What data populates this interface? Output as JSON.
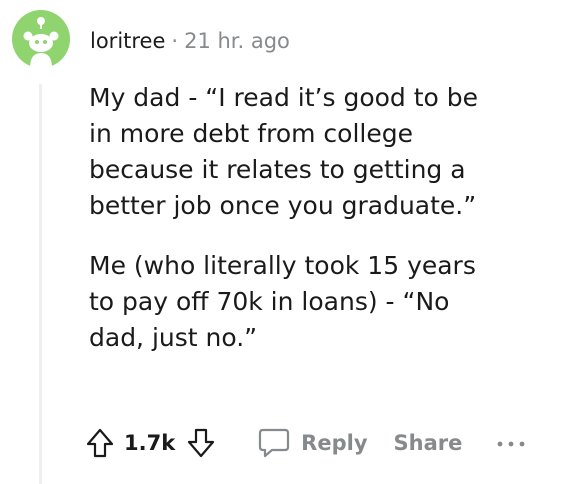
{
  "comment": {
    "author": "loritree",
    "separator": "·",
    "timestamp": "21 hr. ago",
    "paragraphs": [
      "My dad - “I read it’s good to be\nin more debt from college\nbecause it relates to getting a\nbetter job once you graduate.”",
      "Me (who literally took 15 years\nto pay off 70k in loans) - “No\ndad, just no.”"
    ],
    "score": "1.7k",
    "actions": {
      "reply_label": "Reply",
      "share_label": "Share"
    }
  },
  "icons": {
    "avatar": "snoo-avatar-icon",
    "upvote": "arrow-up-icon",
    "downvote": "arrow-down-icon",
    "reply": "speech-bubble-icon",
    "more": "ellipsis-icon"
  },
  "colors": {
    "avatar_background": "#8fd46f",
    "meta_text": "#878a8c",
    "action_text": "#878a8c",
    "thread_line": "#edeff1"
  }
}
